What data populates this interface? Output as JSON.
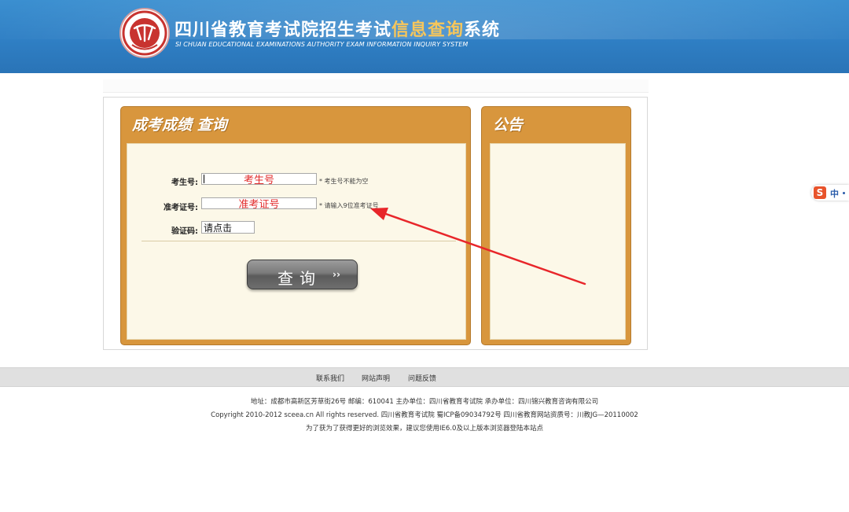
{
  "header": {
    "title_part1": "四川省教育考试院招生考试",
    "title_highlight": "信息查询",
    "title_part2": "系统",
    "subtitle": "SI CHUAN EDUCATIONAL EXAMINATIONS AUTHORITY EXAM INFORMATION INQUIRY SYSTEM",
    "logo_icon": "seal-logo-icon"
  },
  "query_panel": {
    "title": "成考成绩  查询",
    "fields": {
      "exam_number_label": "考生号:",
      "exam_number_value": "考生号",
      "exam_number_hint": "* 考生号不能为空",
      "ticket_label": "准考证号:",
      "ticket_value": "准考证号",
      "ticket_hint": "* 请输入9位准考证号",
      "captcha_label": "验证码:",
      "captcha_value": "请点击"
    },
    "button_label": "查询",
    "button_arrows": "››"
  },
  "notice_panel": {
    "title": "公告"
  },
  "ime": {
    "logo": "S",
    "mode": "中"
  },
  "footer": {
    "links": [
      "联系我们",
      "网站声明",
      "问题反馈"
    ],
    "address": "地址：成都市高新区芳草街26号 邮编：610041      主办单位：四川省教育考试院 承办单位：四川锦兴教育咨询有限公司",
    "copyright": "Copyright 2010-2012 sceea.cn All rights reserved. 四川省教育考试院      蜀ICP备09034792号 四川省教育网站资质号：川教JG—20110002",
    "browser_note": "为了获为了获得更好的浏览效果，建议您使用IE6.0及以上版本浏览器登陆本站点"
  },
  "colors": {
    "header_blue": "#2f7fc4",
    "highlight_gold": "#f6c65b",
    "panel_orange": "#d8963d",
    "panel_body": "#fcf8e8",
    "field_text_red": "#e22a2a",
    "annotation_red": "#e8262a"
  }
}
